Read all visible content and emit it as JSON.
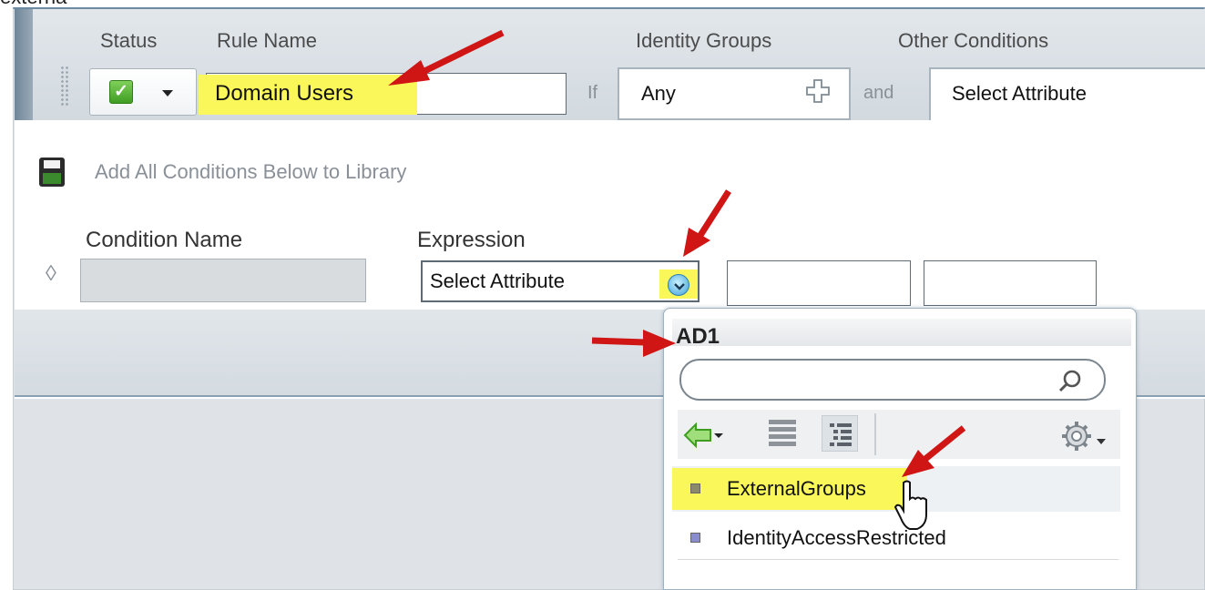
{
  "page": {
    "cut_text": "externa"
  },
  "header": {
    "status_label": "Status",
    "rule_name_label": "Rule Name",
    "identity_groups_label": "Identity Groups",
    "other_conditions_label": "Other Conditions"
  },
  "rule": {
    "status": "enabled",
    "name_value": "Domain Users",
    "if_label": "If",
    "identity_value": "Any",
    "and_label": "and",
    "other_value": "Select Attribute"
  },
  "conditions": {
    "add_all_label": "Add All Conditions Below to Library",
    "condition_name_label": "Condition Name",
    "expression_label": "Expression",
    "expression_value": "Select Attribute"
  },
  "popup": {
    "title": "AD1",
    "search_placeholder": "",
    "items": [
      {
        "label": "ExternalGroups",
        "bullet_color": "#8a8a6a",
        "highlighted": true
      },
      {
        "label": "IdentityAccessRestricted",
        "bullet_color": "#8a8cd0",
        "highlighted": false
      }
    ]
  },
  "colors": {
    "highlight": "#faf75a",
    "annotation_arrow": "#d01515",
    "status_green": "#3f9d22"
  }
}
